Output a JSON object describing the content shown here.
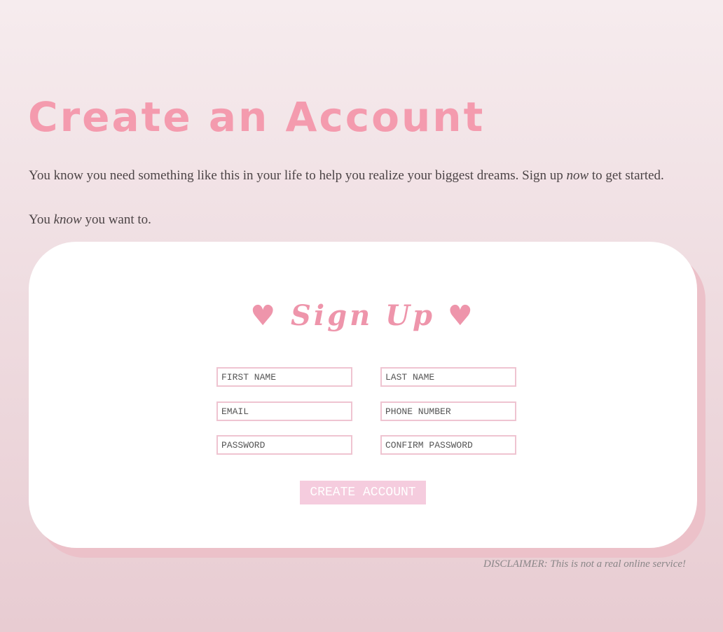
{
  "header": {
    "title": "Create an Account",
    "intro_before": "You know you need something like this in your life to help you realize your biggest dreams. Sign up ",
    "intro_emphasis": "now",
    "intro_after": " to get started.",
    "tagline_before": "You ",
    "tagline_emphasis": "know",
    "tagline_after": " you want to."
  },
  "form": {
    "title_heart_left": "♥",
    "title": "Sign Up",
    "title_heart_right": "♥",
    "fields": {
      "first_name": {
        "placeholder": "FIRST NAME",
        "value": ""
      },
      "last_name": {
        "placeholder": "LAST NAME",
        "value": ""
      },
      "email": {
        "placeholder": "EMAIL",
        "value": ""
      },
      "phone": {
        "placeholder": "PHONE NUMBER",
        "value": ""
      },
      "password": {
        "placeholder": "PASSWORD",
        "value": ""
      },
      "confirm_password": {
        "placeholder": "CONFIRM PASSWORD",
        "value": ""
      }
    },
    "submit_label": "CREATE ACCOUNT"
  },
  "footer": {
    "disclaimer": "DISCLAIMER: This is not a real online service!"
  },
  "colors": {
    "accent_pink": "#f49bae",
    "button_pink": "#f5ccde",
    "field_border": "#efc4d1",
    "card_shadow": "#ecc1c9"
  }
}
